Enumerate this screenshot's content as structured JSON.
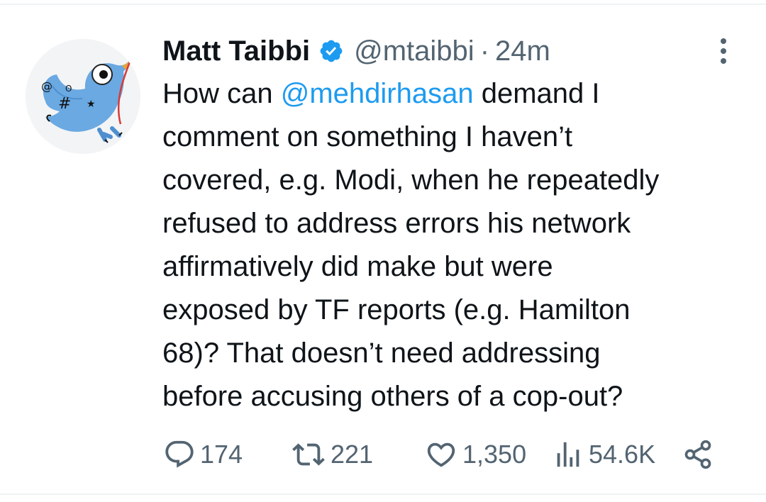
{
  "author": {
    "display_name": "Matt Taibbi",
    "handle": "@mtaibbi",
    "separator": "·",
    "time": "24m",
    "avatar_icon": "twitter-bird-doodle-avatar",
    "verified_icon": "verified-badge-icon",
    "verified_color": "#1d9bf0"
  },
  "tweet": {
    "line1_before": "How can ",
    "line1_mention": "@mehdirhasan",
    "line1_after": " demand I",
    "line2": "comment on something I haven’t",
    "line3": "covered, e.g. Modi, when he repeatedly",
    "line4": "refused to address errors his network",
    "line5": "affirmatively did make but were",
    "line6": "exposed by TF reports (e.g. Hamilton",
    "line7": "68)? That doesn’t need addressing",
    "line8": "before accusing others of a cop-out?"
  },
  "actions": {
    "replies": "174",
    "reposts": "221",
    "likes": "1,350",
    "views": "54.6K",
    "reply_icon": "reply-icon",
    "repost_icon": "repost-icon",
    "like_icon": "heart-icon",
    "views_icon": "analytics-icon",
    "share_icon": "share-icon"
  },
  "colors": {
    "text": "#0f1419",
    "secondary": "#536471",
    "accent": "#1d9bf0",
    "divider": "#eff3f4"
  }
}
